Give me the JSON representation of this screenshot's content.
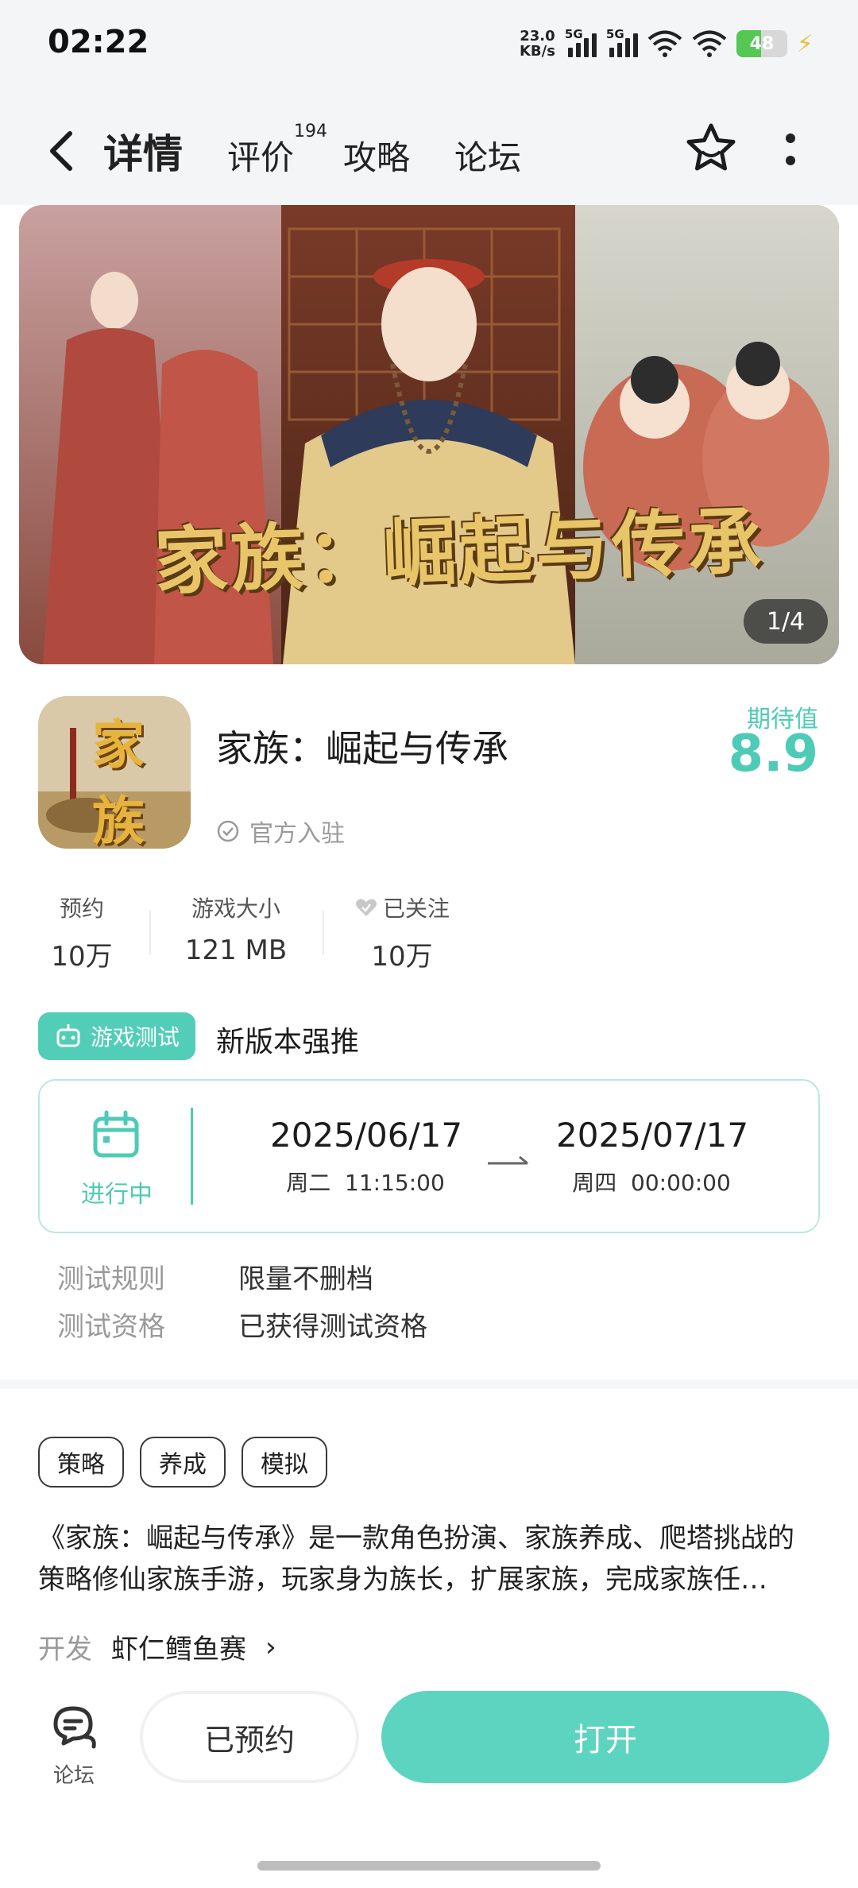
{
  "status_bar": {
    "time": "02:22",
    "net_speed_value": "23.0",
    "net_speed_unit": "KB/s",
    "sim1_label": "5G",
    "sim2_label": "5G",
    "battery_level": 48,
    "battery_text": "48"
  },
  "nav": {
    "tabs": [
      {
        "label": "详情",
        "active": true
      },
      {
        "label": "评价",
        "count": "194"
      },
      {
        "label": "攻略"
      },
      {
        "label": "论坛"
      }
    ]
  },
  "banner": {
    "title_art": "家族：崛起与传承",
    "counter": "1/4"
  },
  "app": {
    "icon_text": "家族",
    "name": "家族：崛起与传承",
    "official_label": "官方入驻",
    "expect_label": "期待值",
    "expect_value": "8.9"
  },
  "stats": [
    {
      "label": "预约",
      "value": "10万"
    },
    {
      "label": "游戏大小",
      "value": "121 MB"
    },
    {
      "label": "已关注",
      "value": "10万"
    }
  ],
  "test": {
    "badge": "游戏测试",
    "headline": "新版本强推",
    "status": "进行中",
    "start_date": "2025/06/17",
    "start_sub": "周二  11:15:00",
    "end_date": "2025/07/17",
    "end_sub": "周四  00:00:00",
    "rules": [
      {
        "key": "测试规则",
        "value": "限量不删档"
      },
      {
        "key": "测试资格",
        "value": "已获得测试资格"
      }
    ]
  },
  "tags": [
    "策略",
    "养成",
    "模拟"
  ],
  "description": "《家族：崛起与传承》是一款角色扮演、家族养成、爬塔挑战的策略修仙家族手游，玩家身为族长，扩展家族，完成家族任…",
  "developer": {
    "label": "开发",
    "name": "虾仁鳕鱼赛"
  },
  "bottom": {
    "forum_label": "论坛",
    "reserved_label": "已预约",
    "open_label": "打开"
  },
  "colors": {
    "accent": "#4ecbb6",
    "button": "#5dd4bf",
    "gold": "#e9c56a"
  }
}
